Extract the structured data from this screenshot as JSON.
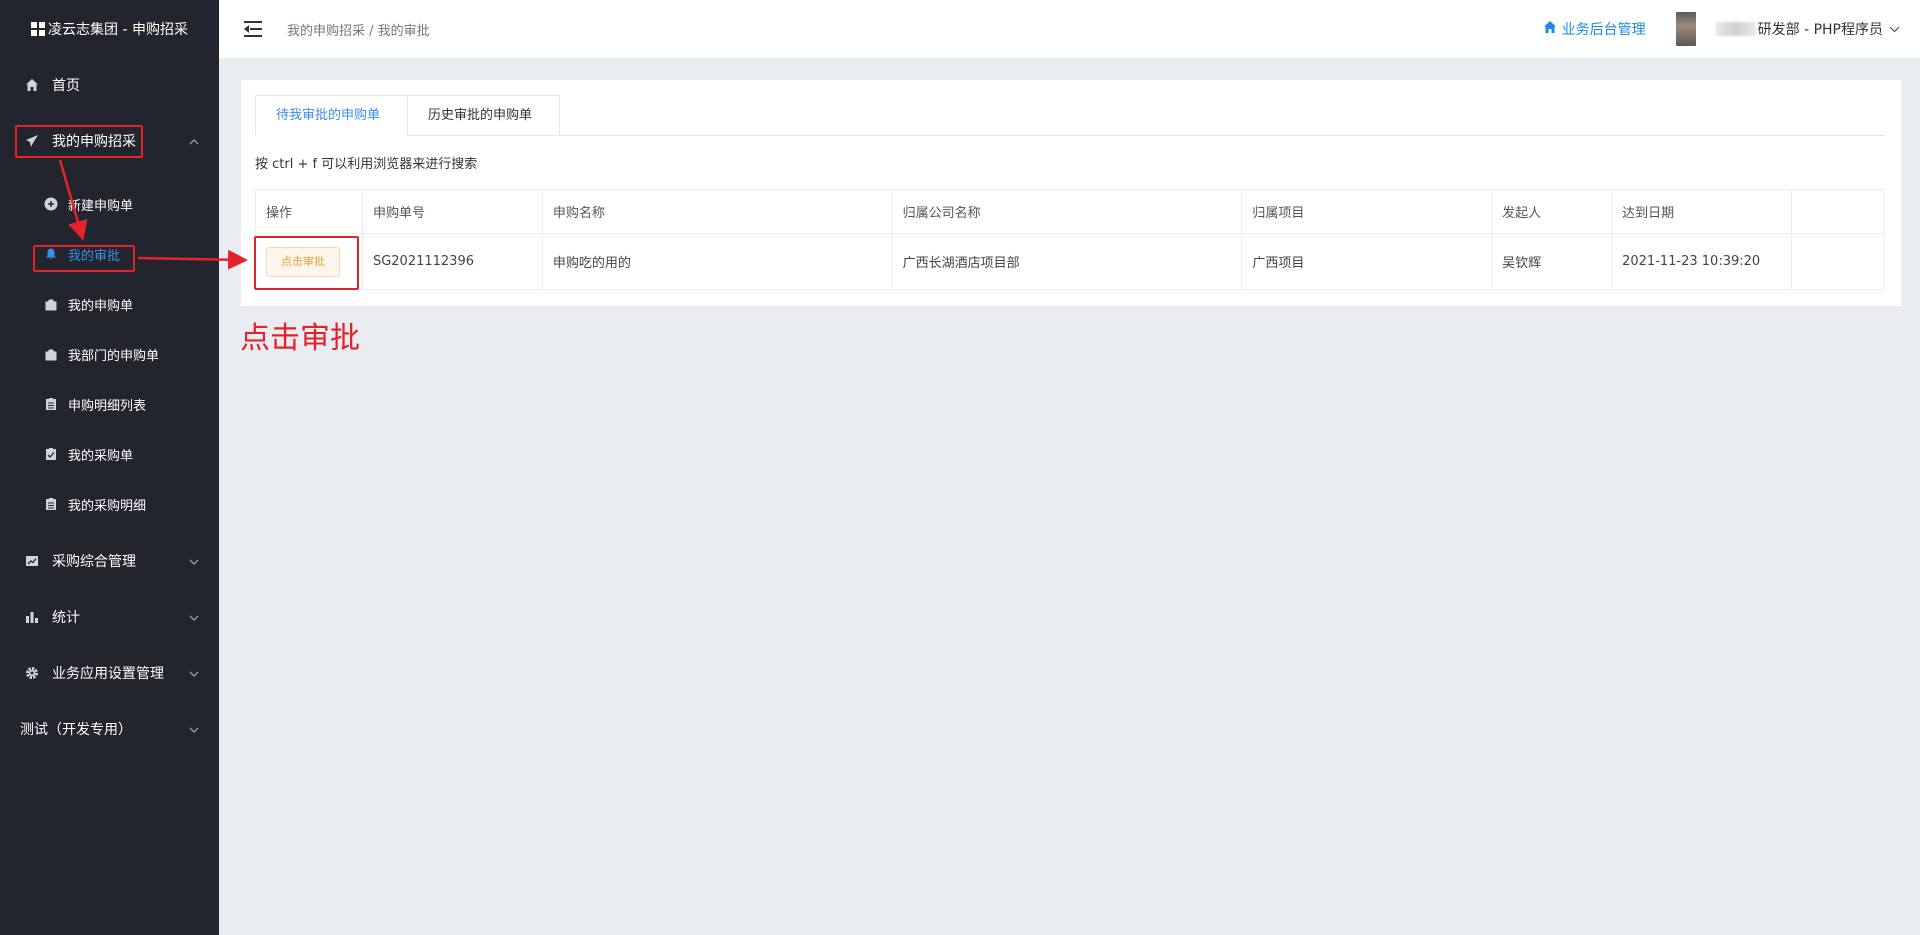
{
  "brand": {
    "title": "凌云志集团 - 申购招采"
  },
  "sidebar": {
    "items": [
      {
        "label": "首页",
        "icon": "home-icon"
      },
      {
        "label": "我的申购招采",
        "icon": "paper-plane-icon"
      },
      {
        "label": "采购综合管理",
        "icon": "chart-line-icon"
      },
      {
        "label": "统计",
        "icon": "bar-chart-icon"
      },
      {
        "label": "业务应用设置管理",
        "icon": "gear-icon"
      },
      {
        "label": "测试（开发专用）"
      }
    ],
    "sub_items": [
      {
        "label": "新建申购单",
        "icon": "plus-circle-icon"
      },
      {
        "label": "我的审批",
        "icon": "bell-icon"
      },
      {
        "label": "我的申购单",
        "icon": "bag-icon"
      },
      {
        "label": "我部门的申购单",
        "icon": "bag-icon"
      },
      {
        "label": "申购明细列表",
        "icon": "clipboard-icon"
      },
      {
        "label": "我的采购单",
        "icon": "clipboard-check-icon"
      },
      {
        "label": "我的采购明细",
        "icon": "clipboard-icon"
      }
    ]
  },
  "header": {
    "breadcrumb": "我的申购招采 / 我的审批",
    "biz_link": "业务后台管理",
    "user": "研发部 - PHP程序员"
  },
  "tabs": [
    {
      "label": "待我审批的申购单",
      "active": true
    },
    {
      "label": "历史审批的申购单",
      "active": false
    }
  ],
  "hint": "按 ctrl + f 可以利用浏览器来进行搜索",
  "table": {
    "headers": [
      "操作",
      "申购单号",
      "申购名称",
      "归属公司名称",
      "归属项目",
      "发起人",
      "达到日期",
      ""
    ],
    "rows": [
      {
        "action": "点击审批",
        "number": "SG2021112396",
        "name": "申购吃的用的",
        "company": "广西长湖酒店项目部",
        "project": "广西项目",
        "initiator": "吴钦辉",
        "date": "2021-11-23 10:39:20"
      }
    ]
  },
  "annotation": "点击审批",
  "colors": {
    "sidebar_bg": "#22252d",
    "active_blue": "#3a8ee6",
    "annotation_red": "#e2232b",
    "page_bg": "#e9edf1"
  }
}
